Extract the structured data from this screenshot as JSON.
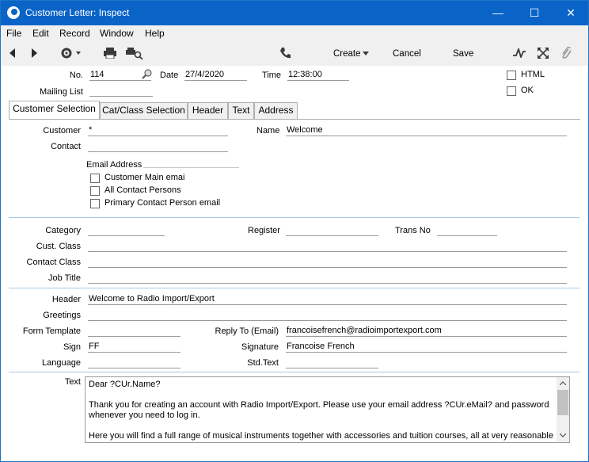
{
  "window": {
    "title": "Customer Letter: Inspect"
  },
  "menu": [
    "File",
    "Edit",
    "Record",
    "Window",
    "Help"
  ],
  "toolbar": {
    "create": "Create",
    "cancel": "Cancel",
    "save": "Save"
  },
  "header_fields": {
    "no_label": "No.",
    "no_value": "114",
    "date_label": "Date",
    "date_value": "27/4/2020",
    "time_label": "Time",
    "time_value": "12:38:00",
    "mailing_label": "Mailing List",
    "mailing_value": "",
    "html_label": "HTML",
    "ok_label": "OK"
  },
  "tabs": [
    "Customer Selection",
    "Cat/Class Selection",
    "Header",
    "Text",
    "Address"
  ],
  "customer_section": {
    "customer_label": "Customer",
    "customer_value": "*",
    "name_label": "Name",
    "name_value": "Welcome",
    "contact_label": "Contact",
    "contact_value": "",
    "email_label": "Email Address",
    "email_options": [
      "Customer Main emai",
      "All Contact Persons",
      "Primary Contact Person email"
    ]
  },
  "class_section": {
    "category_label": "Category",
    "register_label": "Register",
    "transno_label": "Trans No",
    "custclass_label": "Cust. Class",
    "contactclass_label": "Contact Class",
    "jobtitle_label": "Job Title"
  },
  "letter_section": {
    "header_label": "Header",
    "header_value": "Welcome to Radio Import/Export",
    "greetings_label": "Greetings",
    "greetings_value": "",
    "formtemplate_label": "Form Template",
    "formtemplate_value": "",
    "replyto_label": "Reply To (Email)",
    "replyto_value": "francoisefrench@radioimportexport.com",
    "sign_label": "Sign",
    "sign_value": "FF",
    "signature_label": "Signature",
    "signature_value": "Francoise French",
    "language_label": "Language",
    "language_value": "",
    "stdtext_label": "Std.Text",
    "stdtext_value": "",
    "text_label": "Text",
    "text_value": "Dear ?CUr.Name?\n\nThank you for creating an account with Radio Import/Export. Please use your email address ?CUr.eMail? and password whenever you need to log in.\n\nHere you will find a full range of musical instruments together with accessories and tuition courses, all at very reasonable"
  }
}
